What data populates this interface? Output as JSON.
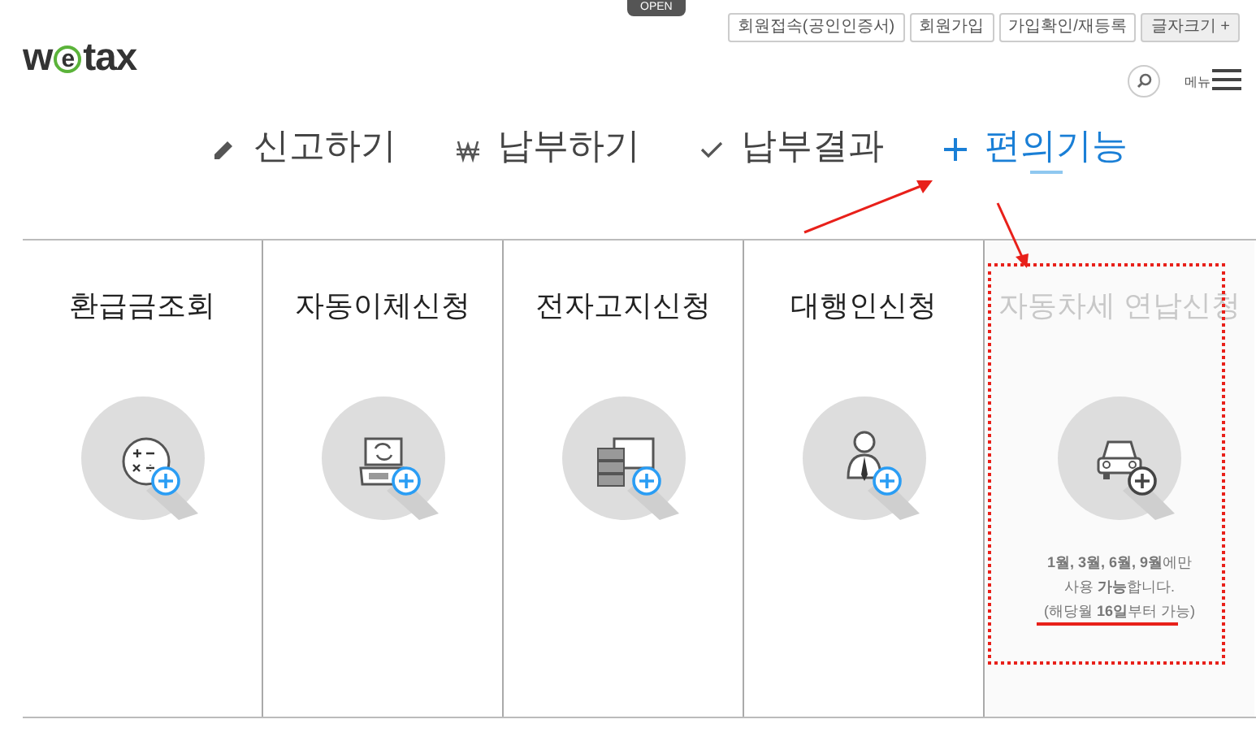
{
  "top_tab": "OPEN",
  "logo": [
    "w",
    "e",
    "tax"
  ],
  "top_links": [
    "회원접속(공인인증서)",
    "회원가입",
    "가입확인/재등록",
    "글자크기 +"
  ],
  "menu_label": "메뉴",
  "nav": [
    {
      "label": "신고하기",
      "kind": "pencil",
      "selected": false
    },
    {
      "label": "납부하기",
      "kind": "won",
      "selected": false
    },
    {
      "label": "납부결과",
      "kind": "check",
      "selected": false
    },
    {
      "label": "편의기능",
      "kind": "plus",
      "selected": true
    }
  ],
  "cards": [
    {
      "title": "환급금조회",
      "kind": "calc",
      "disabled": false
    },
    {
      "title": "자동이체신청",
      "kind": "laptop",
      "disabled": false
    },
    {
      "title": "전자고지신청",
      "kind": "docs",
      "disabled": false
    },
    {
      "title": "대행인신청",
      "kind": "person",
      "disabled": false
    },
    {
      "title": "자동차세 연납신청",
      "kind": "car",
      "disabled": true,
      "notes": [
        "**1월, 3월, 6월, 9월**에만",
        "사용 **가능**합니다.",
        "(해당월 **16일**부터 가능)"
      ]
    }
  ]
}
